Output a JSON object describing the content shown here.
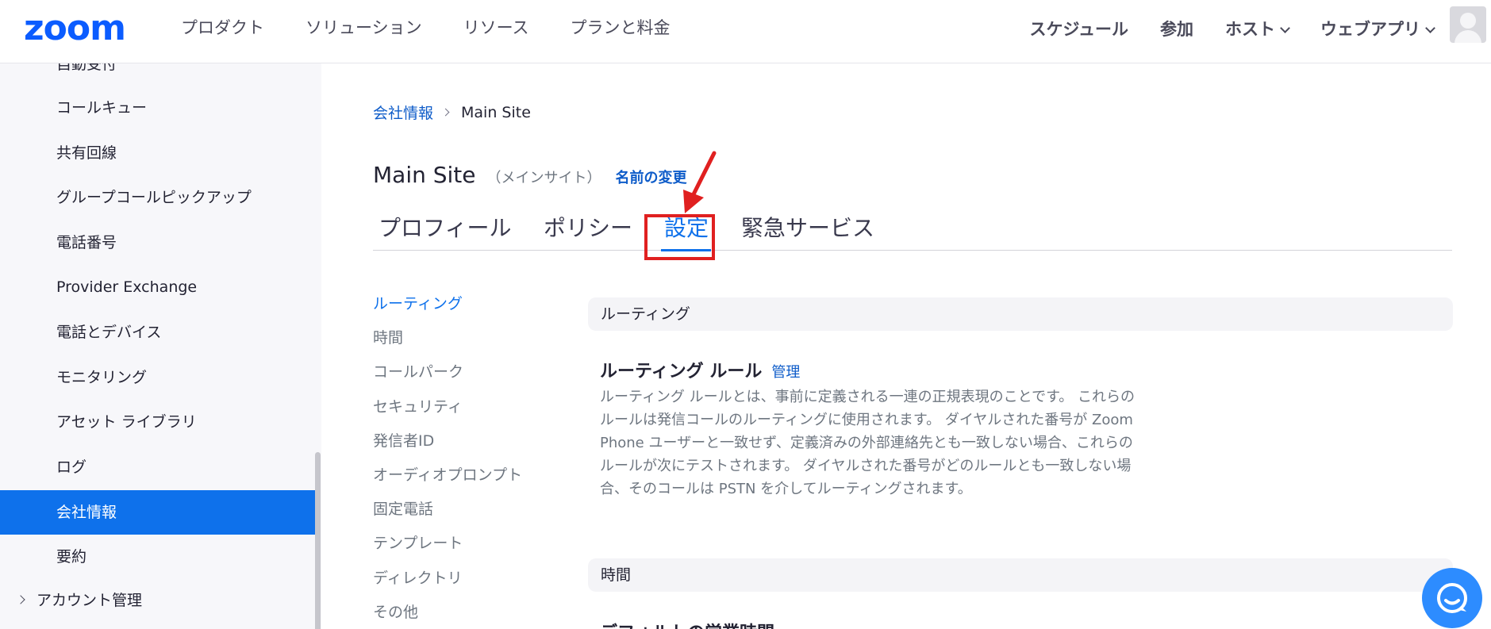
{
  "brand": {
    "logo_text": "zoom",
    "accent": "#0b5cff",
    "link_color": "#0e5cc9",
    "active_color": "#0e71eb",
    "highlight_color": "#e02020"
  },
  "nav": {
    "left": [
      "プロダクト",
      "ソリューション",
      "リソース",
      "プランと料金"
    ],
    "right": [
      {
        "label": "スケジュール",
        "dropdown": false
      },
      {
        "label": "参加",
        "dropdown": false
      },
      {
        "label": "ホスト",
        "dropdown": true
      },
      {
        "label": "ウェブアプリ",
        "dropdown": true
      }
    ],
    "avatar_icon": "user-avatar-icon"
  },
  "sidebar": {
    "items": [
      {
        "label": "自動受付",
        "active": false
      },
      {
        "label": "コールキュー",
        "active": false
      },
      {
        "label": "共有回線",
        "active": false
      },
      {
        "label": "グループコールピックアップ",
        "active": false
      },
      {
        "label": "電話番号",
        "active": false
      },
      {
        "label": "Provider Exchange",
        "active": false
      },
      {
        "label": "電話とデバイス",
        "active": false
      },
      {
        "label": "モニタリング",
        "active": false
      },
      {
        "label": "アセット ライブラリ",
        "active": false
      },
      {
        "label": "ログ",
        "active": false
      },
      {
        "label": "会社情報",
        "active": true
      },
      {
        "label": "要約",
        "active": false
      }
    ],
    "section": {
      "label": "アカウント管理",
      "icon": "chevron-right-icon"
    }
  },
  "breadcrumb": {
    "parent": "会社情報",
    "current": "Main Site"
  },
  "page": {
    "title": "Main Site",
    "subtitle": "（メインサイト）",
    "rename_link": "名前の変更"
  },
  "tabs": [
    {
      "label": "プロフィール",
      "active": false
    },
    {
      "label": "ポリシー",
      "active": false
    },
    {
      "label": "設定",
      "active": true
    },
    {
      "label": "緊急サービス",
      "active": false
    }
  ],
  "subnav": [
    "ルーティング",
    "時間",
    "コールパーク",
    "セキュリティ",
    "発信者ID",
    "オーディオプロンプト",
    "固定電話",
    "テンプレート",
    "ディレクトリ",
    "その他"
  ],
  "sections": {
    "routing": {
      "header": "ルーティング",
      "rule_title": "ルーティング ルール",
      "manage_link": "管理",
      "desc_lines": [
        "ルーティング ルールとは、事前に定義される一連の正規表現のことです。 これらの",
        "ルールは発信コールのルーティングに使用されます。 ダイヤルされた番号が Zoom",
        "Phone ユーザーと一致せず、定義済みの外部連絡先とも一致しない場合、これらの",
        "ルールが次にテストされます。 ダイヤルされた番号がどのルールとも一致しない場",
        "合、そのコールは PSTN を介してルーティングされます。"
      ]
    },
    "hours": {
      "header": "時間",
      "partial_title": "デフォルトの営業時間"
    }
  },
  "chat": {
    "icon": "chat-bubble-icon"
  }
}
